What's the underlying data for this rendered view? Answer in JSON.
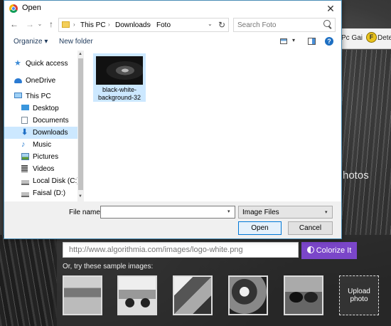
{
  "dialog": {
    "title": "Open",
    "close_glyph": "✕",
    "nav": {
      "back": "←",
      "forward": "→",
      "recent": "⌄",
      "up": "↑",
      "breadcrumbs": [
        "This PC",
        "Downloads",
        "Foto"
      ],
      "separator": "›",
      "dropdown": "⌄",
      "refresh": "↻",
      "search_placeholder": "Search Foto"
    },
    "toolbar": {
      "organize": "Organize ▾",
      "new_folder": "New folder",
      "view_dropdown": "▾",
      "help": "?"
    },
    "nav_pane": {
      "items": [
        {
          "label": "Quick access",
          "icon": "star-icon"
        },
        {
          "label": "OneDrive",
          "icon": "cloud-icon"
        },
        {
          "label": "This PC",
          "icon": "computer-icon"
        },
        {
          "label": "Desktop",
          "icon": "desktop-icon"
        },
        {
          "label": "Documents",
          "icon": "documents-icon"
        },
        {
          "label": "Downloads",
          "icon": "downloads-icon",
          "selected": true
        },
        {
          "label": "Music",
          "icon": "music-icon"
        },
        {
          "label": "Pictures",
          "icon": "pictures-icon"
        },
        {
          "label": "Videos",
          "icon": "videos-icon"
        },
        {
          "label": "Local Disk (C:)",
          "icon": "disk-icon"
        },
        {
          "label": "Faisal (D:)",
          "icon": "disk-icon"
        }
      ],
      "scroll_up": "▲",
      "scroll_down": "▼"
    },
    "files": [
      {
        "name": "black-white-background-32"
      }
    ],
    "footer": {
      "file_name_label": "File name:",
      "file_name_value": "",
      "file_name_dropdown": "▾",
      "file_type": "Image Files",
      "file_type_arrow": "▾",
      "open": "Open",
      "cancel": "Cancel"
    }
  },
  "background_page": {
    "bookmarks": {
      "item1": "Pc Gai",
      "item2_icon_letter": "F",
      "item2": "Detec"
    },
    "hero_text": "hotos",
    "url_placeholder": "http://www.algorithmia.com/images/logo-white.png",
    "colorize_label": "Colorize It",
    "samples_label": "Or, try these sample images:",
    "upload_label": "Upload photo",
    "accent_color": "#7b46c9"
  }
}
